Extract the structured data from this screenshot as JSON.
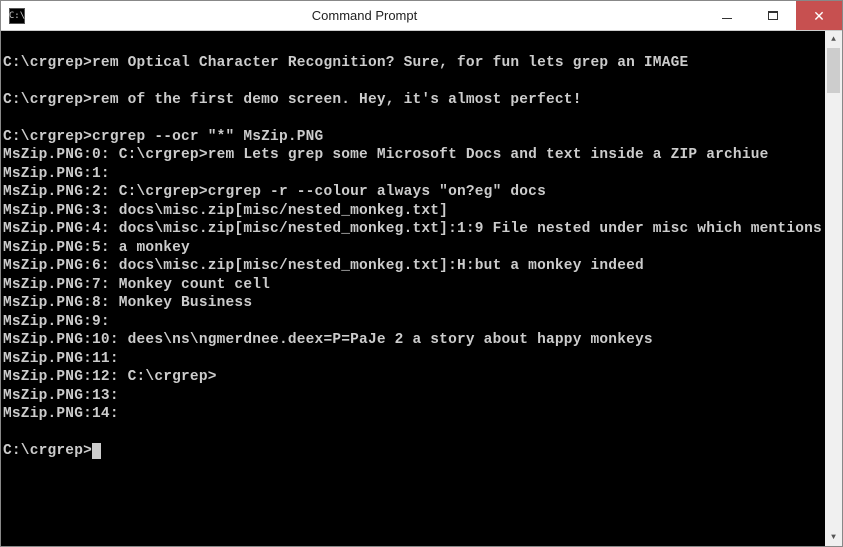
{
  "window": {
    "title": "Command Prompt"
  },
  "terminal": {
    "lines": [
      "",
      "C:\\crgrep>rem Optical Character Recognition? Sure, for fun lets grep an IMAGE",
      "",
      "C:\\crgrep>rem of the first demo screen. Hey, it's almost perfect!",
      "",
      "C:\\crgrep>crgrep --ocr \"*\" MsZip.PNG",
      "MsZip.PNG:0: C:\\crgrep>rem Lets grep some Microsoft Docs and text inside a ZIP archiue",
      "MsZip.PNG:1:",
      "MsZip.PNG:2: C:\\crgrep>crgrep -r --colour always \"on?eg\" docs",
      "MsZip.PNG:3: docs\\misc.zip[misc/nested_monkeg.txt]",
      "MsZip.PNG:4: docs\\misc.zip[misc/nested_monkeg.txt]:1:9 File nested under misc which mentions",
      "MsZip.PNG:5: a monkey",
      "MsZip.PNG:6: docs\\misc.zip[misc/nested_monkeg.txt]:H:but a monkey indeed",
      "MsZip.PNG:7: Monkey count cell",
      "MsZip.PNG:8: Monkey Business",
      "MsZip.PNG:9:",
      "MsZip.PNG:10: dees\\ns\\ngmerdnee.deex=P=PaJe 2 a story about happy monkeys",
      "MsZip.PNG:11:",
      "MsZip.PNG:12: C:\\crgrep>",
      "MsZip.PNG:13:",
      "MsZip.PNG:14:",
      "",
      "C:\\crgrep>"
    ],
    "cursor_line_index": 22
  }
}
